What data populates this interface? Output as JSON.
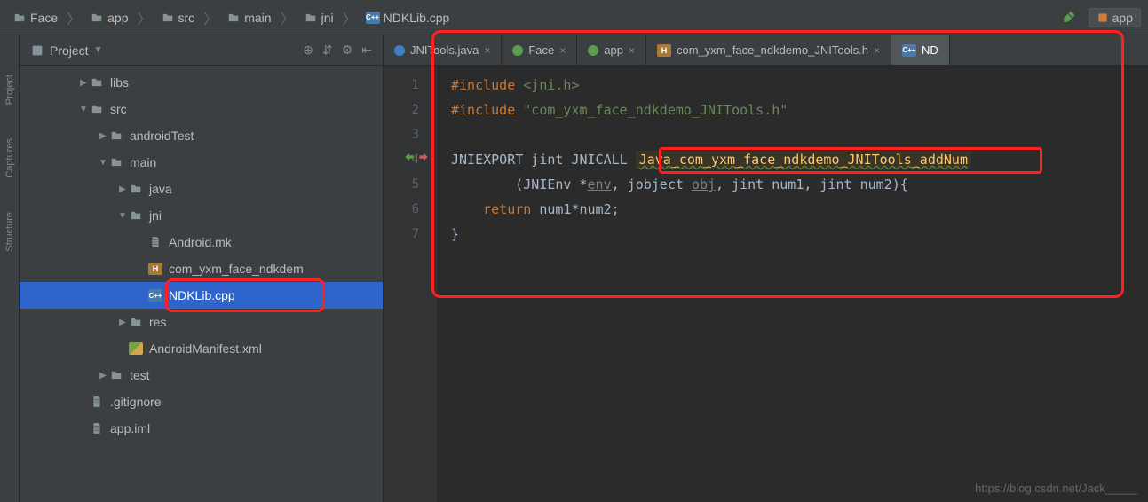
{
  "breadcrumbs": [
    "Face",
    "app",
    "src",
    "main",
    "jni",
    "NDKLib.cpp"
  ],
  "top_right": {
    "config_label": "app"
  },
  "project_panel": {
    "title": "Project",
    "tree": [
      {
        "label": "libs",
        "depth": 3,
        "arrow": "▶",
        "type": "folder"
      },
      {
        "label": "src",
        "depth": 3,
        "arrow": "▼",
        "type": "folder"
      },
      {
        "label": "androidTest",
        "depth": 4,
        "arrow": "▶",
        "type": "folder"
      },
      {
        "label": "main",
        "depth": 4,
        "arrow": "▼",
        "type": "folder"
      },
      {
        "label": "java",
        "depth": 5,
        "arrow": "▶",
        "type": "folder"
      },
      {
        "label": "jni",
        "depth": 5,
        "arrow": "▼",
        "type": "folder"
      },
      {
        "label": "Android.mk",
        "depth": 6,
        "arrow": "",
        "type": "txt"
      },
      {
        "label": "com_yxm_face_ndkdem",
        "depth": 6,
        "arrow": "",
        "type": "h"
      },
      {
        "label": "NDKLib.cpp",
        "depth": 6,
        "arrow": "",
        "type": "cpp",
        "selected": true,
        "boxed": true
      },
      {
        "label": "res",
        "depth": 5,
        "arrow": "▶",
        "type": "folder"
      },
      {
        "label": "AndroidManifest.xml",
        "depth": 5,
        "arrow": "",
        "type": "xml"
      },
      {
        "label": "test",
        "depth": 4,
        "arrow": "▶",
        "type": "folder"
      },
      {
        "label": ".gitignore",
        "depth": 3,
        "arrow": "",
        "type": "txt"
      },
      {
        "label": "app.iml",
        "depth": 3,
        "arrow": "",
        "type": "iml"
      }
    ]
  },
  "editor_tabs": [
    {
      "label": "JNITools.java",
      "icon": "blue"
    },
    {
      "label": "Face",
      "icon": "green"
    },
    {
      "label": "app",
      "icon": "green"
    },
    {
      "label": "com_yxm_face_ndkdemo_JNITools.h",
      "icon": "h"
    },
    {
      "label": "ND",
      "icon": "cpp",
      "active": true
    }
  ],
  "code": {
    "lines": [
      {
        "n": 1,
        "segs": [
          [
            "kw-orange",
            "#include "
          ],
          [
            "kw-angle",
            "<jni.h>"
          ]
        ]
      },
      {
        "n": 2,
        "segs": [
          [
            "kw-orange",
            "#include "
          ],
          [
            "kw-string",
            "\"com_yxm_face_ndkdemo_JNITools.h\""
          ]
        ]
      },
      {
        "n": 3,
        "segs": [
          [
            "kw-white",
            ""
          ]
        ]
      },
      {
        "n": 4,
        "segs": [
          [
            "kw-white",
            "JNIEXPORT jint JNICALL "
          ],
          [
            "highlight-fn kw-yellow",
            "Java_com_yxm_face_ndkdemo_JNITools_addNum"
          ]
        ]
      },
      {
        "n": 5,
        "segs": [
          [
            "kw-white",
            "        (JNIEnv *"
          ],
          [
            "kw-param",
            "env"
          ],
          [
            "kw-white",
            ", jobject "
          ],
          [
            "kw-param",
            "obj"
          ],
          [
            "kw-white",
            ", jint num1, jint num2)"
          ],
          [
            "kw-white",
            "{"
          ]
        ]
      },
      {
        "n": 6,
        "segs": [
          [
            "kw-white",
            "    "
          ],
          [
            "kw-orange",
            "return "
          ],
          [
            "kw-white",
            "num1*num2;"
          ]
        ]
      },
      {
        "n": 7,
        "segs": [
          [
            "kw-white",
            "}"
          ]
        ]
      }
    ]
  },
  "watermark": "https://blog.csdn.net/Jack_____"
}
